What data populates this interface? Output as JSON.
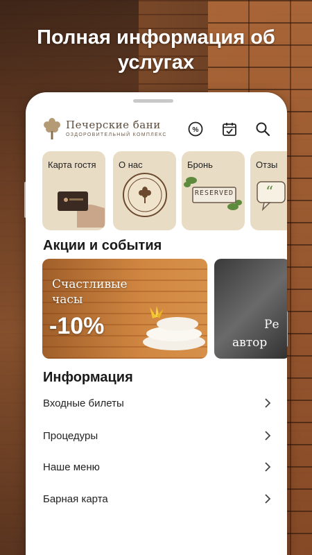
{
  "headline": "Полная информация об услугах",
  "brand": {
    "name": "Печерские бани",
    "tagline": "ОЗДОРОВИТЕЛЬНЫЙ КОМПЛЕКС"
  },
  "header_icons": [
    "discount-icon",
    "calendar-check-icon",
    "search-icon"
  ],
  "tiles": [
    {
      "label": "Карта гостя",
      "icon": "guest-card"
    },
    {
      "label": "О нас",
      "icon": "stamp-logo"
    },
    {
      "label": "Бронь",
      "icon": "reserved-sign"
    },
    {
      "label": "Отзы",
      "icon": "quote"
    }
  ],
  "reserved_sign": "RESERVED",
  "promo_section": {
    "title": "Акции и события",
    "banners": [
      {
        "line1": "Счастливые",
        "line2": "часы",
        "discount": "-10%"
      },
      {
        "line1": "Ре",
        "line2": "автор"
      }
    ]
  },
  "info_section": {
    "title": "Информация",
    "items": [
      {
        "label": "Входные билеты"
      },
      {
        "label": "Процедуры"
      },
      {
        "label": "Наше меню"
      },
      {
        "label": "Барная карта"
      }
    ]
  },
  "colors": {
    "tile_bg": "#e9dcc4",
    "brand_brown": "#5d4b3a"
  }
}
